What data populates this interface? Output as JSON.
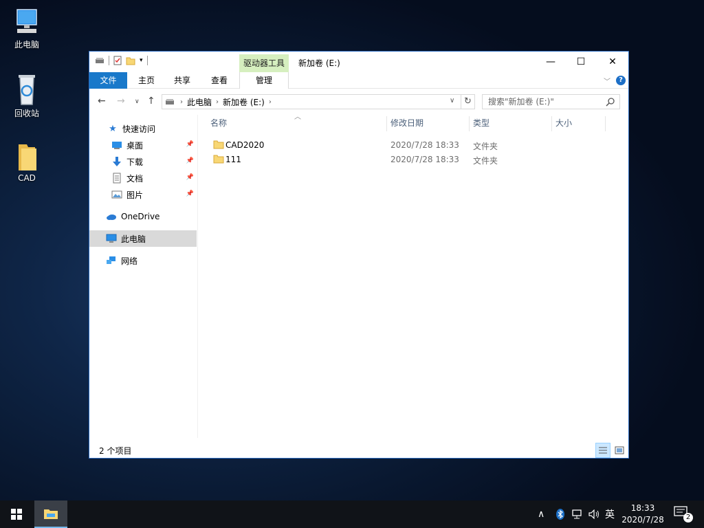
{
  "desktop": {
    "icons": [
      {
        "label": "此电脑",
        "icon": "this-pc-icon"
      },
      {
        "label": "回收站",
        "icon": "recycle-bin-icon"
      },
      {
        "label": "CAD",
        "icon": "folder-icon"
      }
    ]
  },
  "window": {
    "title": "新加卷 (E:)",
    "context_tab_group": "驱动器工具",
    "controls": {
      "minimize": "—",
      "maximize": "☐",
      "close": "✕"
    },
    "ribbon_tabs": [
      "文件",
      "主页",
      "共享",
      "查看",
      "管理"
    ],
    "help_label": "?",
    "address": {
      "segments": [
        "此电脑",
        "新加卷 (E:)"
      ]
    },
    "search_placeholder": "搜索\"新加卷 (E:)\"",
    "nav_pane": {
      "quick_access": "快速访问",
      "pinned": [
        {
          "label": "桌面",
          "icon": "desktop-icon"
        },
        {
          "label": "下载",
          "icon": "download-icon"
        },
        {
          "label": "文档",
          "icon": "documents-icon"
        },
        {
          "label": "图片",
          "icon": "pictures-icon"
        }
      ],
      "onedrive": "OneDrive",
      "this_pc": "此电脑",
      "network": "网络"
    },
    "columns": [
      "名称",
      "修改日期",
      "类型",
      "大小"
    ],
    "files": [
      {
        "name": "CAD2020",
        "modified": "2020/7/28 18:33",
        "type": "文件夹",
        "size": ""
      },
      {
        "name": "111",
        "modified": "2020/7/28 18:33",
        "type": "文件夹",
        "size": ""
      }
    ],
    "status": "2 个项目"
  },
  "taskbar": {
    "ime": "英",
    "time": "18:33",
    "date": "2020/7/28",
    "notifications": "2"
  },
  "colors": {
    "accent": "#1979ca",
    "context_tab": "#d6efbf",
    "folder": "#f8d775",
    "selection": "#d9d9d9"
  }
}
